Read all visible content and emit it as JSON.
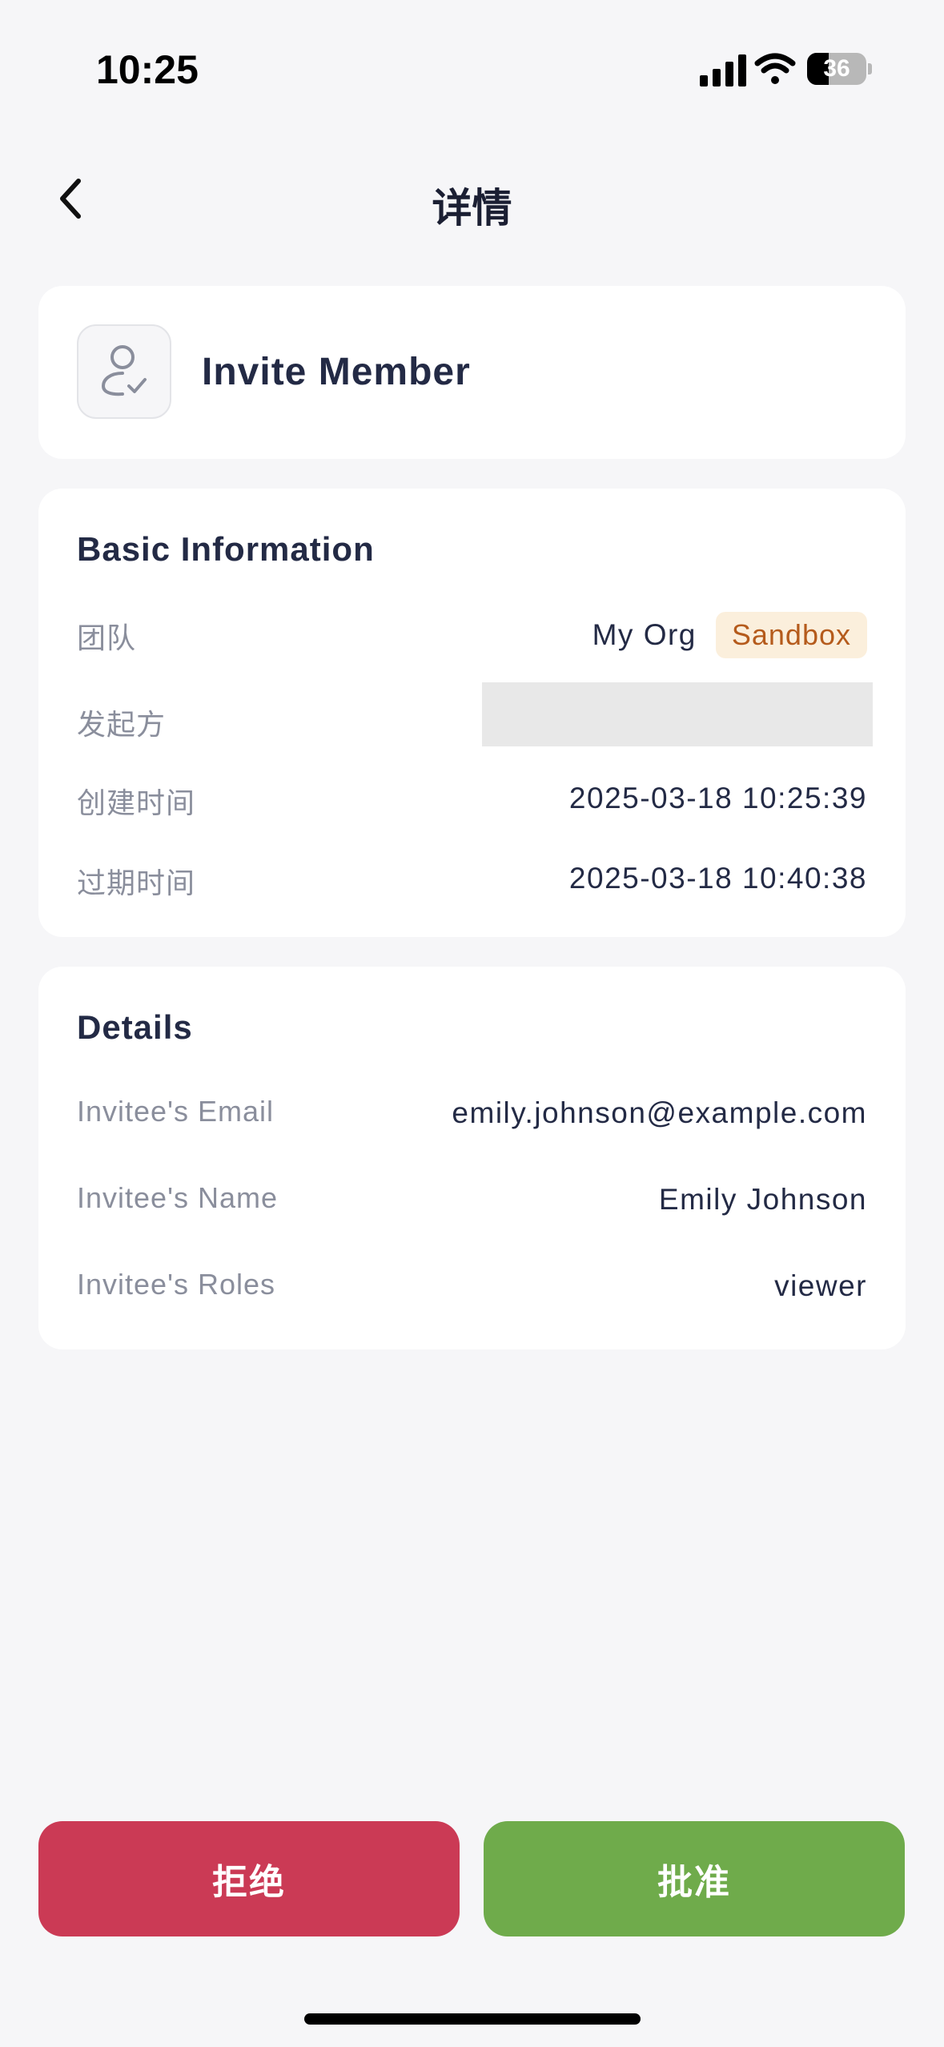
{
  "status_bar": {
    "time": "10:25",
    "battery_percent": "36",
    "battery_level": 0.36,
    "icons": [
      "cellular-signal-icon",
      "wifi-icon",
      "battery-icon"
    ]
  },
  "nav": {
    "title": "详情",
    "back_icon": "chevron-left-icon"
  },
  "header": {
    "icon": "user-check-icon",
    "title": "Invite Member"
  },
  "basic_info": {
    "title": "Basic Information",
    "team_label": "团队",
    "team_value": "My Org",
    "team_env_badge": "Sandbox",
    "initiator_label": "发起方",
    "created_label": "创建时间",
    "created_value": "2025-03-18 10:25:39",
    "expires_label": "过期时间",
    "expires_value": "2025-03-18 10:40:38"
  },
  "details": {
    "title": "Details",
    "email_label": "Invitee's Email",
    "email_value": "emily.johnson@example.com",
    "name_label": "Invitee's Name",
    "name_value": "Emily Johnson",
    "roles_label": "Invitee's Roles",
    "roles_value": "viewer"
  },
  "actions": {
    "reject_label": "拒绝",
    "approve_label": "批准"
  },
  "colors": {
    "background": "#f6f6f8",
    "reject": "#cb3a55",
    "approve": "#6fab4b",
    "badge_bg": "#fbefdc",
    "badge_text": "#b55b1c"
  }
}
